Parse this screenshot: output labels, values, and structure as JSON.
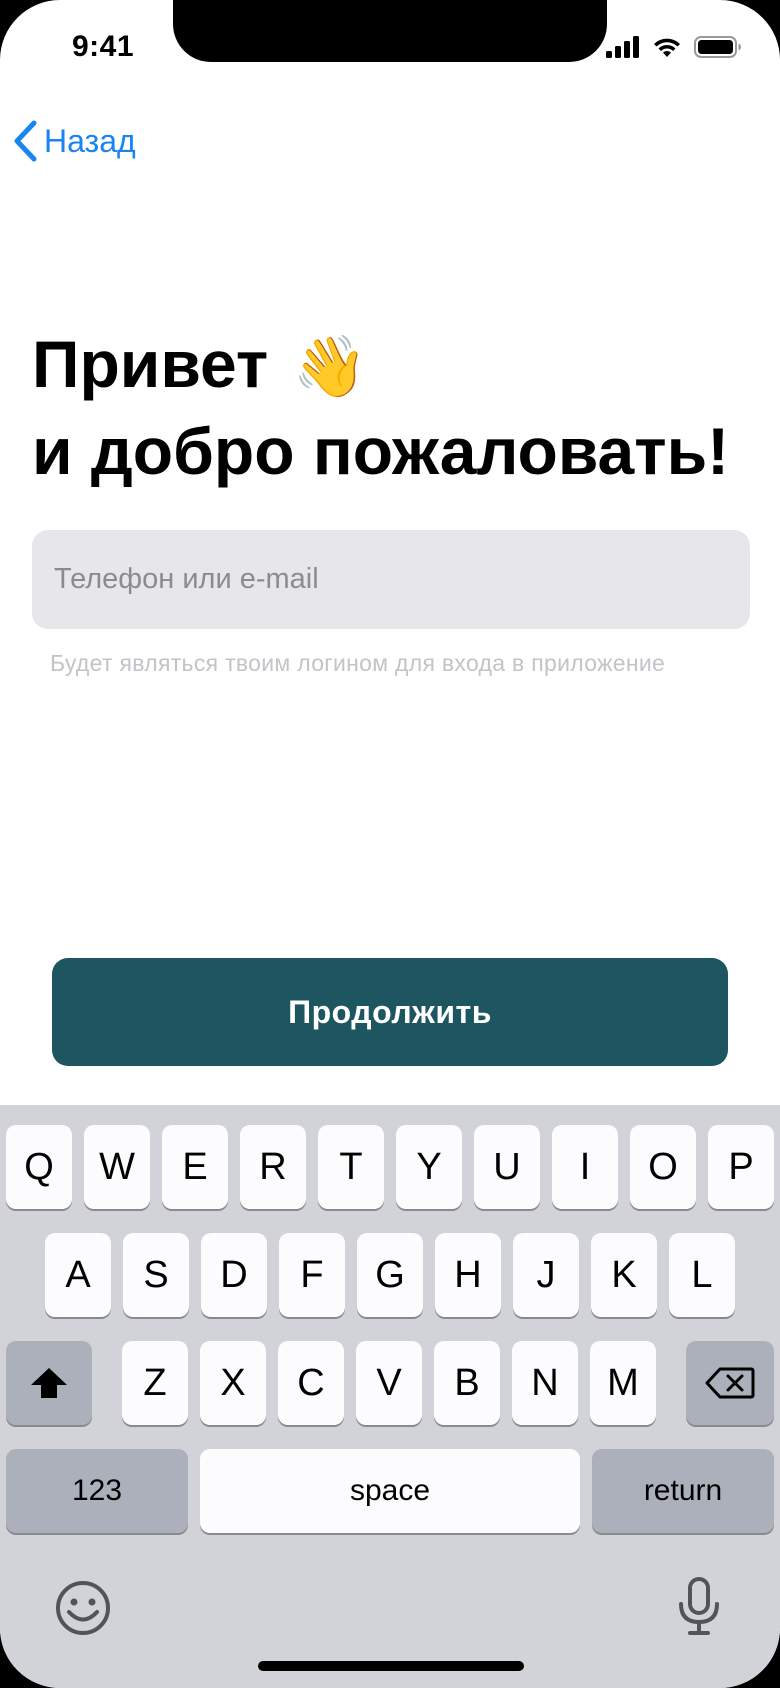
{
  "status_bar": {
    "time": "9:41"
  },
  "nav": {
    "back_label": "Назад"
  },
  "heading": {
    "line1": "Привет",
    "emoji": "👋",
    "line2": "и добро пожаловать!"
  },
  "login_field": {
    "placeholder": "Телефон или e-mail",
    "value": ""
  },
  "hint": "Будет являться твоим логином для входа в приложение",
  "continue_button": "Продолжить",
  "keyboard": {
    "row1": [
      "Q",
      "W",
      "E",
      "R",
      "T",
      "Y",
      "U",
      "I",
      "O",
      "P"
    ],
    "row2": [
      "A",
      "S",
      "D",
      "F",
      "G",
      "H",
      "J",
      "K",
      "L"
    ],
    "row3": [
      "Z",
      "X",
      "C",
      "V",
      "B",
      "N",
      "M"
    ],
    "numbers_key": "123",
    "space_key": "space",
    "return_key": "return"
  },
  "colors": {
    "accent": "#1a84f0",
    "button": "#1d5560",
    "field_bg": "#e6e6eb"
  }
}
